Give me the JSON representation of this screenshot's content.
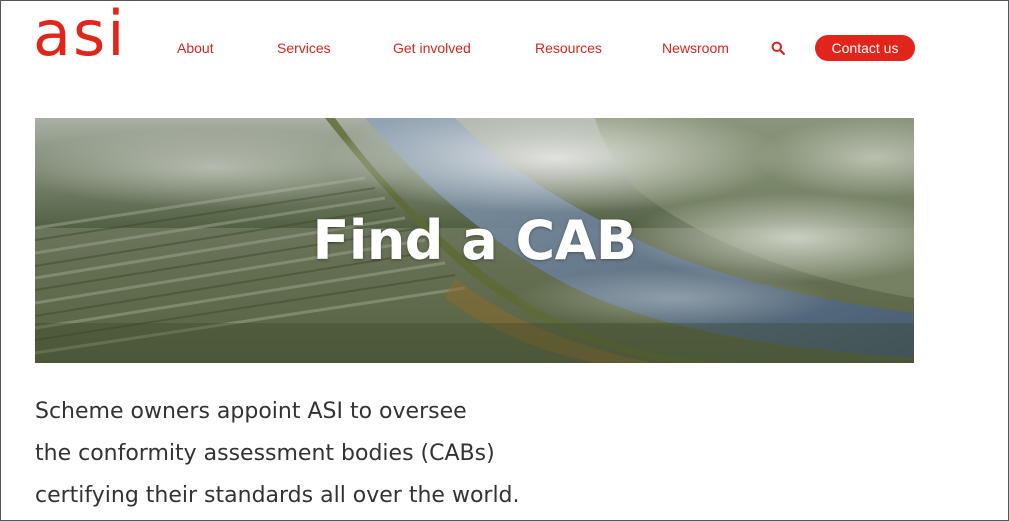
{
  "brand": {
    "logo_text": "asi",
    "accent_color": "#e1251b"
  },
  "nav": {
    "items": [
      {
        "label": "About"
      },
      {
        "label": "Services"
      },
      {
        "label": "Get involved"
      },
      {
        "label": "Resources"
      },
      {
        "label": "Newsroom"
      }
    ],
    "search_icon": "search-icon",
    "contact_label": "Contact us"
  },
  "hero": {
    "title": "Find a CAB",
    "image": "aerial-misty-forest-river"
  },
  "intro": {
    "lines": [
      "Scheme owners appoint ASI to oversee",
      "the conformity assessment bodies (CABs)",
      "certifying their standards all over the world."
    ]
  }
}
